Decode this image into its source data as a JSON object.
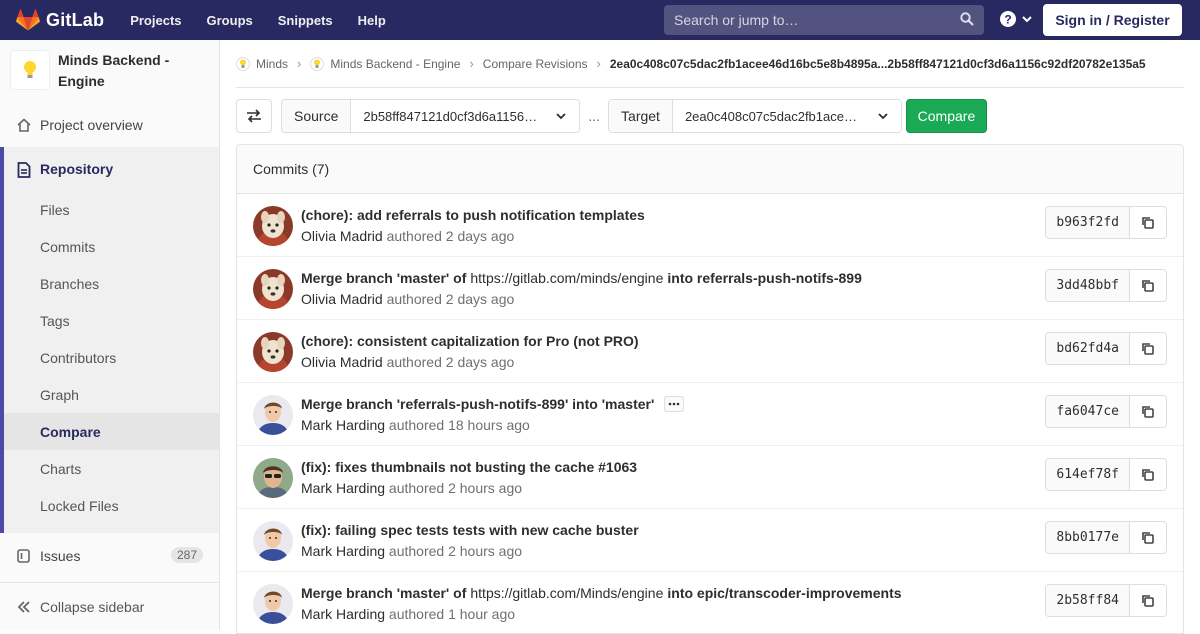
{
  "navbar": {
    "brand": "GitLab",
    "links": [
      "Projects",
      "Groups",
      "Snippets",
      "Help"
    ],
    "search_placeholder": "Search or jump to…",
    "signin_label": "Sign in / Register",
    "brand_color": "#292961"
  },
  "sidebar": {
    "project_name": "Minds Backend - Engine",
    "overview": "Project overview",
    "repository": "Repository",
    "repo_items": [
      "Files",
      "Commits",
      "Branches",
      "Tags",
      "Contributors",
      "Graph",
      "Compare",
      "Charts",
      "Locked Files"
    ],
    "active_item": "Compare",
    "issues_label": "Issues",
    "issues_count": "287",
    "collapse_label": "Collapse sidebar"
  },
  "breadcrumb": {
    "items": [
      "Minds",
      "Minds Backend - Engine",
      "Compare Revisions"
    ],
    "current": "2ea0c408c07c5dac2fb1acee46d16bc5e8b4895a...2b58ff847121d0cf3d6a1156c92df20782e135a5"
  },
  "compare": {
    "source_label": "Source",
    "source_value": "2b58ff847121d0cf3d6a1156c92df20782e135a5",
    "separator": "...",
    "target_label": "Target",
    "target_value": "2ea0c408c07c5dac2fb1acee46d16bc5e8b4895a",
    "button_label": "Compare",
    "button_color": "#1aaa55"
  },
  "commits": {
    "header": "Commits (7)",
    "rows": [
      {
        "title_bold": "(chore): add referrals to push notification templates",
        "title_plain": "",
        "title_bold2": "",
        "author": "Olivia Madrid",
        "verb": "authored",
        "time": "2 days ago",
        "sha": "b963f2fd",
        "avatar": "dog"
      },
      {
        "title_bold": "Merge branch 'master' of",
        "title_plain": "https://gitlab.com/minds/engine",
        "title_bold2": "into referrals-push-notifs-899",
        "author": "Olivia Madrid",
        "verb": "authored",
        "time": "2 days ago",
        "sha": "3dd48bbf",
        "avatar": "dog"
      },
      {
        "title_bold": "(chore): consistent capitalization for Pro (not PRO)",
        "title_plain": "",
        "title_bold2": "",
        "author": "Olivia Madrid",
        "verb": "authored",
        "time": "2 days ago",
        "sha": "bd62fd4a",
        "avatar": "dog"
      },
      {
        "title_bold": "Merge branch 'referrals-push-notifs-899' into 'master'",
        "title_plain": "",
        "title_bold2": "",
        "author": "Mark Harding",
        "verb": "authored",
        "time": "18 hours ago",
        "sha": "fa6047ce",
        "avatar": "man"
      },
      {
        "title_bold": "(fix): fixes thumbnails not busting the cache #1063",
        "title_plain": "",
        "title_bold2": "",
        "author": "Mark Harding",
        "verb": "authored",
        "time": "2 hours ago",
        "sha": "614ef78f",
        "avatar": "man-sunglasses"
      },
      {
        "title_bold": "(fix): failing spec tests tests with new cache buster",
        "title_plain": "",
        "title_bold2": "",
        "author": "Mark Harding",
        "verb": "authored",
        "time": "2 hours ago",
        "sha": "8bb0177e",
        "avatar": "man"
      },
      {
        "title_bold": "Merge branch 'master' of",
        "title_plain": "https://gitlab.com/Minds/engine",
        "title_bold2": "into epic/transcoder-improvements",
        "author": "Mark Harding",
        "verb": "authored",
        "time": "1 hour ago",
        "sha": "2b58ff84",
        "avatar": "man"
      }
    ]
  }
}
